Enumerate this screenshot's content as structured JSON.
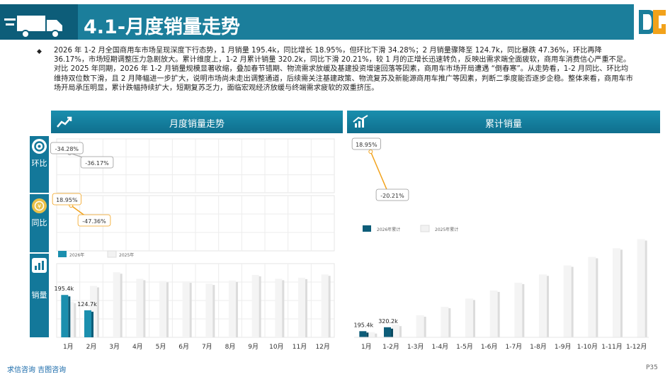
{
  "header": {
    "title": "4.1-月度销量走势"
  },
  "paragraph": "2026 年 1-2 月全国商用车市场呈现深度下行态势，1 月销量 195.4k，同比增长 18.95%，但环比下滑 34.28%；2 月销量骤降至 124.7k，同比暴跌 47.36%，环比再降 36.17%，市场短期调整压力急剧放大。累计维度上，1-2 月累计销量 320.2k，同比下滑 20.21%，较 1 月的正增长迅速转负，反映出需求端全面疲软，商用车消费信心严重不足。对比 2025 年同期，2026 年 1-2 月销量规模显著收缩，叠加春节错期、物流需求放缓及基建投资增速回落等因素，商用车市场开局遭遇 “倒春寒”。从走势看，1-2 月同比、环比均维持双位数下滑，且 2 月降幅进一步扩大，说明市场尚未走出调整通道，后续需关注基建政策、物流复苏及新能源商用车推广等因素，判断二季度能否逐步企稳。整体来看，商用车市场开局承压明显，累计跌幅持续扩大，短期复苏乏力，面临宏观经济放缓与终端需求疲软的双重挤压。",
  "tabs": {
    "left": "月度销量走势",
    "right": "累计销量"
  },
  "side": {
    "mom": "环比",
    "yoy": "同比",
    "sales": "销量"
  },
  "colors": {
    "primary": "#1b8fae",
    "dark": "#0d5d79",
    "grey": "#f2f2f2",
    "orange": "#f2a21b",
    "red": "#c00000"
  },
  "footer": {
    "left": "求信咨询  吉图咨询",
    "page": "P35"
  },
  "chart_data": [
    {
      "type": "bar",
      "categories": [
        "1月",
        "2月",
        "3月",
        "4月",
        "5月",
        "6月",
        "7月",
        "8月",
        "9月",
        "10月",
        "11月",
        "12月"
      ],
      "legend": [
        "2026年",
        "2025年"
      ],
      "series": [
        {
          "name": "2026年",
          "values": [
            195.4,
            124.7,
            null,
            null,
            null,
            null,
            null,
            null,
            null,
            null,
            null,
            null
          ],
          "labels": [
            "195.4k",
            "124.7k"
          ]
        },
        {
          "name": "2025年",
          "values": [
            164.2,
            236.9,
            300,
            270,
            260,
            258,
            248,
            262,
            288,
            270,
            275,
            290
          ]
        }
      ],
      "mom": {
        "values": [
          -34.28,
          -36.17
        ],
        "labels": [
          "-34.28%",
          "-36.17%"
        ]
      },
      "yoy": {
        "values": [
          18.95,
          -47.36
        ],
        "labels": [
          "18.95%",
          "-47.36%"
        ]
      }
    },
    {
      "type": "bar",
      "categories": [
        "1月",
        "1-2月",
        "1-3月",
        "1-4月",
        "1-5月",
        "1-6月",
        "1-7月",
        "1-8月",
        "1-9月",
        "1-10月",
        "1-11月",
        "1-12月"
      ],
      "legend": [
        "2026年累计",
        "2025年累计"
      ],
      "series": [
        {
          "name": "2026年累计",
          "values": [
            195.4,
            320.2,
            null,
            null,
            null,
            null,
            null,
            null,
            null,
            null,
            null,
            null
          ],
          "labels": [
            "195.4k",
            "320.2k"
          ]
        },
        {
          "name": "2025年累计",
          "values": [
            164.2,
            401.1,
            701,
            971,
            1231,
            1489,
            1737,
            1999,
            2287,
            2557,
            2832,
            3122
          ]
        }
      ],
      "yoy": {
        "values": [
          18.95,
          -20.21
        ],
        "labels": [
          "18.95%",
          "-20.21%"
        ]
      }
    }
  ]
}
